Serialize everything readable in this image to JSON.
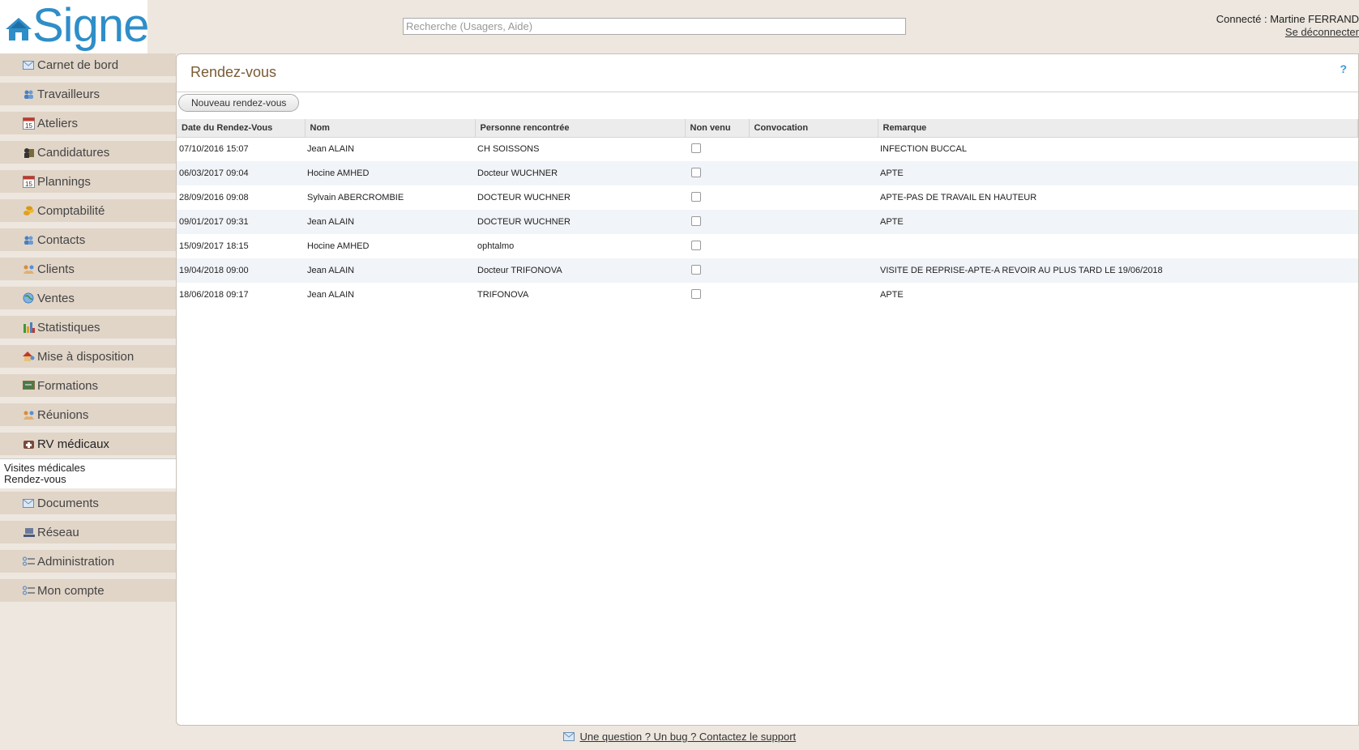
{
  "header": {
    "logo_text": "Signe",
    "search_placeholder": "Recherche (Usagers, Aide)",
    "connected_label": "Connecté : Martine FERRAND",
    "logout": "Se déconnecter"
  },
  "sidebar": {
    "items": [
      {
        "label": "Carnet de bord",
        "icon": "envelope-icon"
      },
      {
        "label": "Travailleurs",
        "icon": "people-icon"
      },
      {
        "label": "Ateliers",
        "icon": "calendar-icon"
      },
      {
        "label": "Candidatures",
        "icon": "folder-user-icon"
      },
      {
        "label": "Plannings",
        "icon": "calendar-icon"
      },
      {
        "label": "Comptabilité",
        "icon": "coins-icon"
      },
      {
        "label": "Contacts",
        "icon": "people-icon"
      },
      {
        "label": "Clients",
        "icon": "handshake-icon"
      },
      {
        "label": "Ventes",
        "icon": "globe-icon"
      },
      {
        "label": "Statistiques",
        "icon": "bar-chart-icon"
      },
      {
        "label": "Mise à disposition",
        "icon": "house-user-icon"
      },
      {
        "label": "Formations",
        "icon": "board-icon"
      },
      {
        "label": "Réunions",
        "icon": "handshake-icon"
      },
      {
        "label": "RV médicaux",
        "icon": "medical-icon"
      }
    ],
    "submenu": [
      "Visites médicales",
      "Rendez-vous"
    ],
    "items_after": [
      {
        "label": "Documents",
        "icon": "envelope-icon"
      },
      {
        "label": "Réseau",
        "icon": "network-icon"
      },
      {
        "label": "Administration",
        "icon": "list-icon"
      },
      {
        "label": "Mon compte",
        "icon": "list-icon"
      }
    ]
  },
  "main": {
    "title": "Rendez-vous",
    "help": "?",
    "new_button": "Nouveau rendez-vous",
    "columns": [
      "Date du Rendez-Vous",
      "Nom",
      "Personne rencontrée",
      "Non venu",
      "Convocation",
      "Remarque"
    ],
    "rows": [
      {
        "date": "07/10/2016 15:07",
        "nom": "Jean ALAIN",
        "personne": "CH SOISSONS",
        "convocation": "",
        "remarque": "INFECTION BUCCAL"
      },
      {
        "date": "06/03/2017 09:04",
        "nom": "Hocine AMHED",
        "personne": "Docteur WUCHNER",
        "convocation": "",
        "remarque": "APTE"
      },
      {
        "date": "28/09/2016 09:08",
        "nom": "Sylvain ABERCROMBIE",
        "personne": "DOCTEUR WUCHNER",
        "convocation": "",
        "remarque": "APTE-PAS DE TRAVAIL EN HAUTEUR"
      },
      {
        "date": "09/01/2017 09:31",
        "nom": "Jean ALAIN",
        "personne": "DOCTEUR WUCHNER",
        "convocation": "",
        "remarque": "APTE"
      },
      {
        "date": "15/09/2017 18:15",
        "nom": "Hocine AMHED",
        "personne": "ophtalmo",
        "convocation": "",
        "remarque": ""
      },
      {
        "date": "19/04/2018 09:00",
        "nom": "Jean ALAIN",
        "personne": "Docteur TRIFONOVA",
        "convocation": "",
        "remarque": "VISITE DE REPRISE-APTE-A REVOIR AU PLUS TARD LE 19/06/2018"
      },
      {
        "date": "18/06/2018 09:17",
        "nom": "Jean ALAIN",
        "personne": "TRIFONOVA",
        "convocation": "",
        "remarque": "APTE"
      }
    ]
  },
  "footer": {
    "support_link": "Une question ? Un bug ? Contactez le support"
  }
}
